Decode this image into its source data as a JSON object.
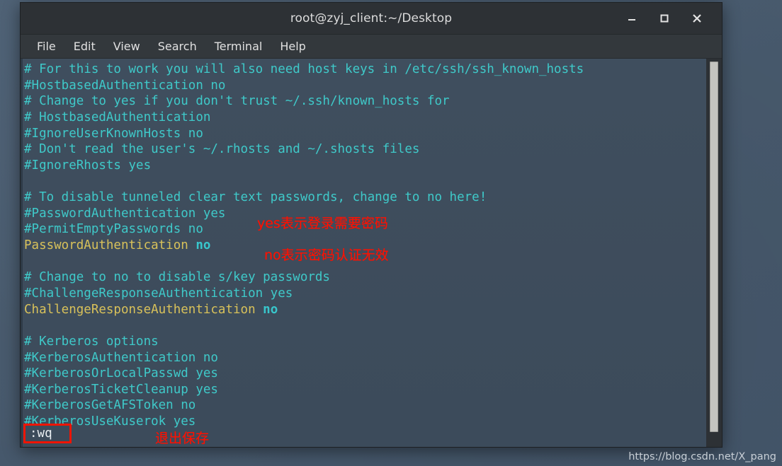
{
  "window": {
    "title": "root@zyj_client:~/Desktop",
    "buttons": [
      {
        "name": "minimize",
        "glyph": "minimize-icon"
      },
      {
        "name": "maximize",
        "glyph": "maximize-icon"
      },
      {
        "name": "close",
        "glyph": "close-icon"
      }
    ]
  },
  "menubar": {
    "items": [
      "File",
      "Edit",
      "View",
      "Search",
      "Terminal",
      "Help"
    ]
  },
  "terminal": {
    "lines": [
      {
        "segments": [
          {
            "text": "# For this to work you will also need host keys in /etc/ssh/ssh_known_hosts",
            "style": "cyan"
          }
        ]
      },
      {
        "segments": [
          {
            "text": "#HostbasedAuthentication no",
            "style": "cyan"
          }
        ]
      },
      {
        "segments": [
          {
            "text": "# Change to yes if you don't trust ~/.ssh/known_hosts for",
            "style": "cyan"
          }
        ]
      },
      {
        "segments": [
          {
            "text": "# HostbasedAuthentication",
            "style": "cyan"
          }
        ]
      },
      {
        "segments": [
          {
            "text": "#IgnoreUserKnownHosts no",
            "style": "cyan"
          }
        ]
      },
      {
        "segments": [
          {
            "text": "# Don't read the user's ~/.rhosts and ~/.shosts files",
            "style": "cyan"
          }
        ]
      },
      {
        "segments": [
          {
            "text": "#IgnoreRhosts yes",
            "style": "cyan"
          }
        ]
      },
      {
        "segments": [
          {
            "text": "",
            "style": "cyan"
          }
        ]
      },
      {
        "segments": [
          {
            "text": "# To disable tunneled clear text passwords, change to no here!",
            "style": "cyan"
          }
        ]
      },
      {
        "segments": [
          {
            "text": "#PasswordAuthentication yes",
            "style": "cyan"
          }
        ]
      },
      {
        "segments": [
          {
            "text": "#PermitEmptyPasswords no",
            "style": "cyan"
          }
        ]
      },
      {
        "segments": [
          {
            "text": "PasswordAuthentication ",
            "style": "yellow"
          },
          {
            "text": "no",
            "style": "val"
          }
        ]
      },
      {
        "segments": [
          {
            "text": "",
            "style": "cyan"
          }
        ]
      },
      {
        "segments": [
          {
            "text": "# Change to no to disable s/key passwords",
            "style": "cyan"
          }
        ]
      },
      {
        "segments": [
          {
            "text": "#ChallengeResponseAuthentication yes",
            "style": "cyan"
          }
        ]
      },
      {
        "segments": [
          {
            "text": "ChallengeResponseAuthentication ",
            "style": "yellow"
          },
          {
            "text": "no",
            "style": "val"
          }
        ]
      },
      {
        "segments": [
          {
            "text": "",
            "style": "cyan"
          }
        ]
      },
      {
        "segments": [
          {
            "text": "# Kerberos options",
            "style": "cyan"
          }
        ]
      },
      {
        "segments": [
          {
            "text": "#KerberosAuthentication no",
            "style": "cyan"
          }
        ]
      },
      {
        "segments": [
          {
            "text": "#KerberosOrLocalPasswd yes",
            "style": "cyan"
          }
        ]
      },
      {
        "segments": [
          {
            "text": "#KerberosTicketCleanup yes",
            "style": "cyan"
          }
        ]
      },
      {
        "segments": [
          {
            "text": "#KerberosGetAFSToken no",
            "style": "cyan"
          }
        ]
      },
      {
        "segments": [
          {
            "text": "#KerberosUseKuserok yes",
            "style": "cyan"
          }
        ]
      }
    ],
    "command_line": ":wq"
  },
  "annotations": {
    "yes_note": "yes表示登录需要密码",
    "no_note": "no表示密码认证无效",
    "save_note": "退出保存"
  },
  "watermark": "https://blog.csdn.net/X_pang",
  "colors": {
    "desktop_bg": "#4a5c70",
    "terminal_bg": "#3d4c5c",
    "titlebar_bg": "#2d3135",
    "menubar_bg": "#33383c",
    "comment_cyan": "#3fc9c9",
    "directive_yellow": "#d8c15a",
    "value_cyan": "#38c6cc",
    "annotation_red": "#ff1000",
    "scrollbar_thumb": "#c4c4c0"
  }
}
